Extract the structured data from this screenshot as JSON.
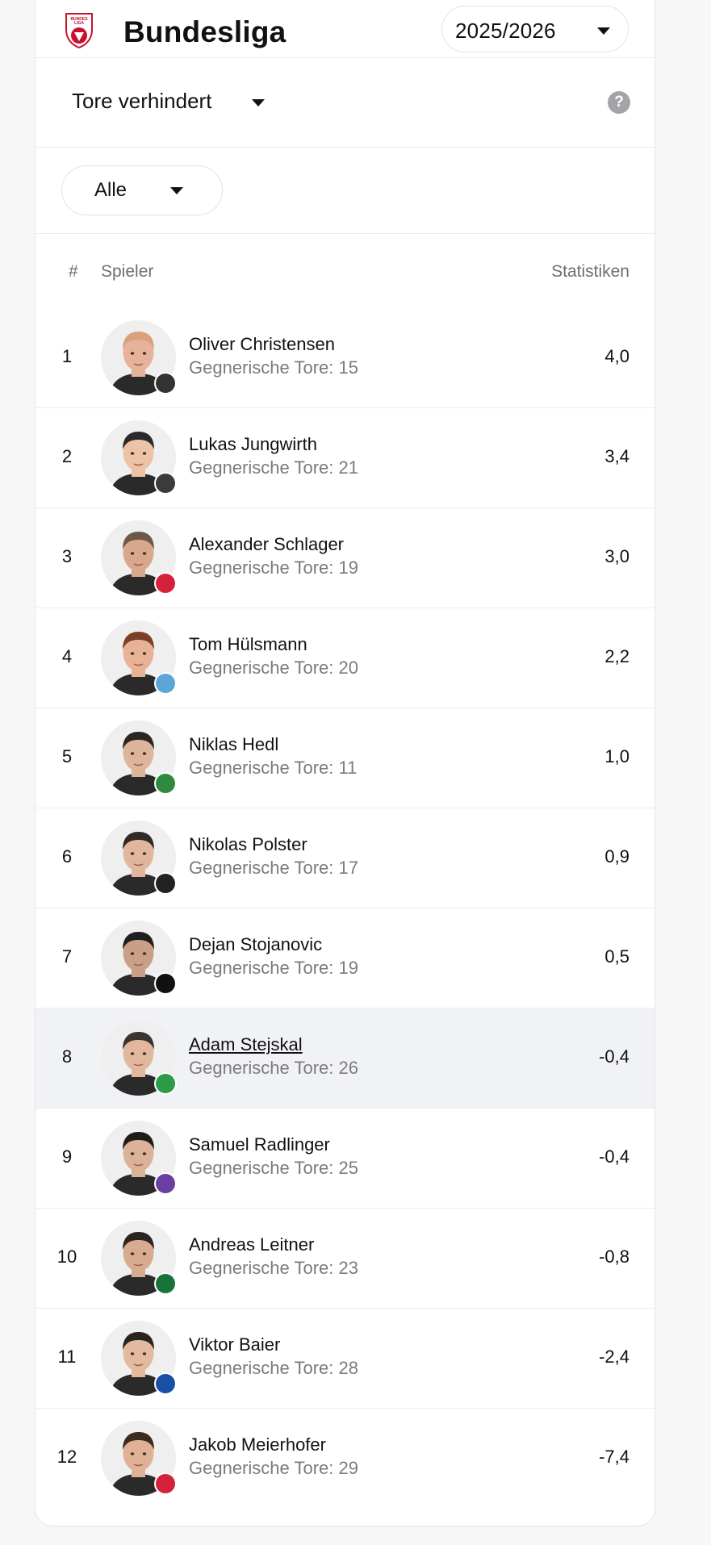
{
  "header": {
    "logo_icon": "bundesliga-logo",
    "title": "Bundesliga",
    "season": "2025/2026"
  },
  "metric": {
    "label": "Tore verhindert",
    "help_symbol": "?"
  },
  "filter": {
    "label": "Alle"
  },
  "table": {
    "col_rank": "#",
    "col_player": "Spieler",
    "col_stats": "Statistiken"
  },
  "players": [
    {
      "rank": "1",
      "name": "Oliver Christensen",
      "sub": "Gegnerische Tore: 15",
      "stat": "4,0",
      "skin": "#e6b39a",
      "hair": "#d9a27a",
      "badge": "#333333"
    },
    {
      "rank": "2",
      "name": "Lukas Jungwirth",
      "sub": "Gegnerische Tore: 21",
      "stat": "3,4",
      "skin": "#ecc3a6",
      "hair": "#2a2a2a",
      "badge": "#3b3b3b"
    },
    {
      "rank": "3",
      "name": "Alexander Schlager",
      "sub": "Gegnerische Tore: 19",
      "stat": "3,0",
      "skin": "#d9a78c",
      "hair": "#6d5848",
      "badge": "#d6213a"
    },
    {
      "rank": "4",
      "name": "Tom Hülsmann",
      "sub": "Gegnerische Tore: 20",
      "stat": "2,2",
      "skin": "#e8b296",
      "hair": "#7a3f24",
      "badge": "#5da5d9"
    },
    {
      "rank": "5",
      "name": "Niklas Hedl",
      "sub": "Gegnerische Tore: 11",
      "stat": "1,0",
      "skin": "#dcb59b",
      "hair": "#2b2622",
      "badge": "#2e8b3e"
    },
    {
      "rank": "6",
      "name": "Nikolas Polster",
      "sub": "Gegnerische Tore: 17",
      "stat": "0,9",
      "skin": "#e0b79d",
      "hair": "#2f2a27",
      "badge": "#222222"
    },
    {
      "rank": "7",
      "name": "Dejan Stojanovic",
      "sub": "Gegnerische Tore: 19",
      "stat": "0,5",
      "skin": "#c9a087",
      "hair": "#1f1f1f",
      "badge": "#111111"
    },
    {
      "rank": "8",
      "name": "Adam Stejskal",
      "sub": "Gegnerische Tore: 26",
      "stat": "-0,4",
      "skin": "#e1b89e",
      "hair": "#3a3430",
      "badge": "#2e9b4a"
    },
    {
      "rank": "9",
      "name": "Samuel Radlinger",
      "sub": "Gegnerische Tore: 25",
      "stat": "-0,4",
      "skin": "#dbb198",
      "hair": "#201c1a",
      "badge": "#6a3fa0"
    },
    {
      "rank": "10",
      "name": "Andreas Leitner",
      "sub": "Gegnerische Tore: 23",
      "stat": "-0,8",
      "skin": "#d8ab90",
      "hair": "#2b2522",
      "badge": "#17733a"
    },
    {
      "rank": "11",
      "name": "Viktor Baier",
      "sub": "Gegnerische Tore: 28",
      "stat": "-2,4",
      "skin": "#e3b99f",
      "hair": "#2a2420",
      "badge": "#1a4fa8"
    },
    {
      "rank": "12",
      "name": "Jakob Meierhofer",
      "sub": "Gegnerische Tore: 29",
      "stat": "-7,4",
      "skin": "#e0b196",
      "hair": "#3b2c22",
      "badge": "#d6213a"
    }
  ],
  "highlighted_rank": "8",
  "colors": {
    "accent_red": "#c8102e",
    "muted_text": "#7b7b80",
    "highlight_row": "#f1f2f5"
  }
}
